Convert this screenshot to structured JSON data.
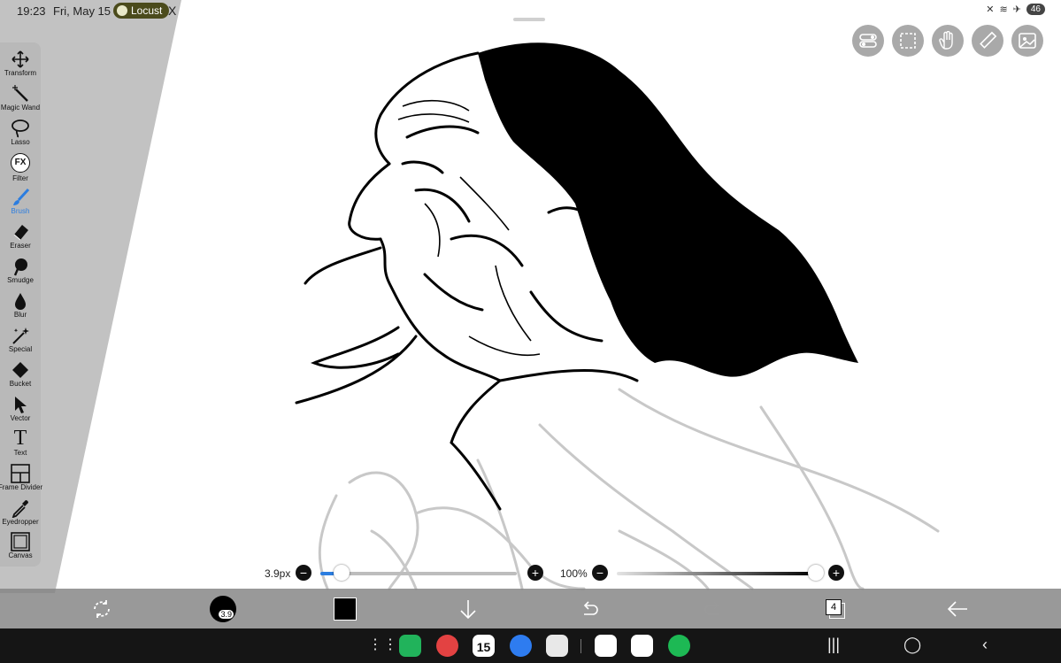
{
  "status_bar": {
    "time": "19:23",
    "date": "Fri, May 15",
    "media_pill": "Locust",
    "x_label": "X",
    "battery": "46"
  },
  "toolbar": {
    "tools": [
      {
        "label": "Transform",
        "icon": "transform-icon"
      },
      {
        "label": "Magic Wand",
        "icon": "magic-wand-icon"
      },
      {
        "label": "Lasso",
        "icon": "lasso-icon"
      },
      {
        "label": "Filter",
        "icon": "fx-icon"
      },
      {
        "label": "Brush",
        "icon": "brush-icon",
        "active": true
      },
      {
        "label": "Eraser",
        "icon": "eraser-icon"
      },
      {
        "label": "Smudge",
        "icon": "smudge-icon"
      },
      {
        "label": "Blur",
        "icon": "blur-drop-icon"
      },
      {
        "label": "Special",
        "icon": "special-sparkle-icon"
      },
      {
        "label": "Bucket",
        "icon": "bucket-icon"
      },
      {
        "label": "Vector",
        "icon": "vector-arrow-icon"
      },
      {
        "label": "Text",
        "icon": "text-icon"
      },
      {
        "label": "Frame Divider",
        "icon": "frame-divider-icon"
      },
      {
        "label": "Eyedropper",
        "icon": "eyedropper-icon"
      },
      {
        "label": "Canvas",
        "icon": "canvas-icon"
      }
    ],
    "fx_glyph": "FX",
    "text_glyph": "T"
  },
  "brush_size": {
    "value_label": "3.9px",
    "level": 0.07
  },
  "opacity": {
    "value_label": "100%",
    "level": 1.0
  },
  "bottom_bar": {
    "layers_count": "4",
    "brush_preview_label": "3.9",
    "color": "#000000"
  },
  "colors": {
    "accent": "#2b7de0",
    "toolbar_bg": "#b9b9b9",
    "bottom_bar_bg": "#828282"
  },
  "dock": {
    "calendar_day": "15",
    "apps": [
      "phone-app-icon",
      "contacts-app-icon",
      "calendar-app-icon",
      "messages-app-icon",
      "camera-app-icon",
      "ibispaint-app-icon",
      "gmail-app-icon",
      "spotify-app-icon"
    ]
  }
}
